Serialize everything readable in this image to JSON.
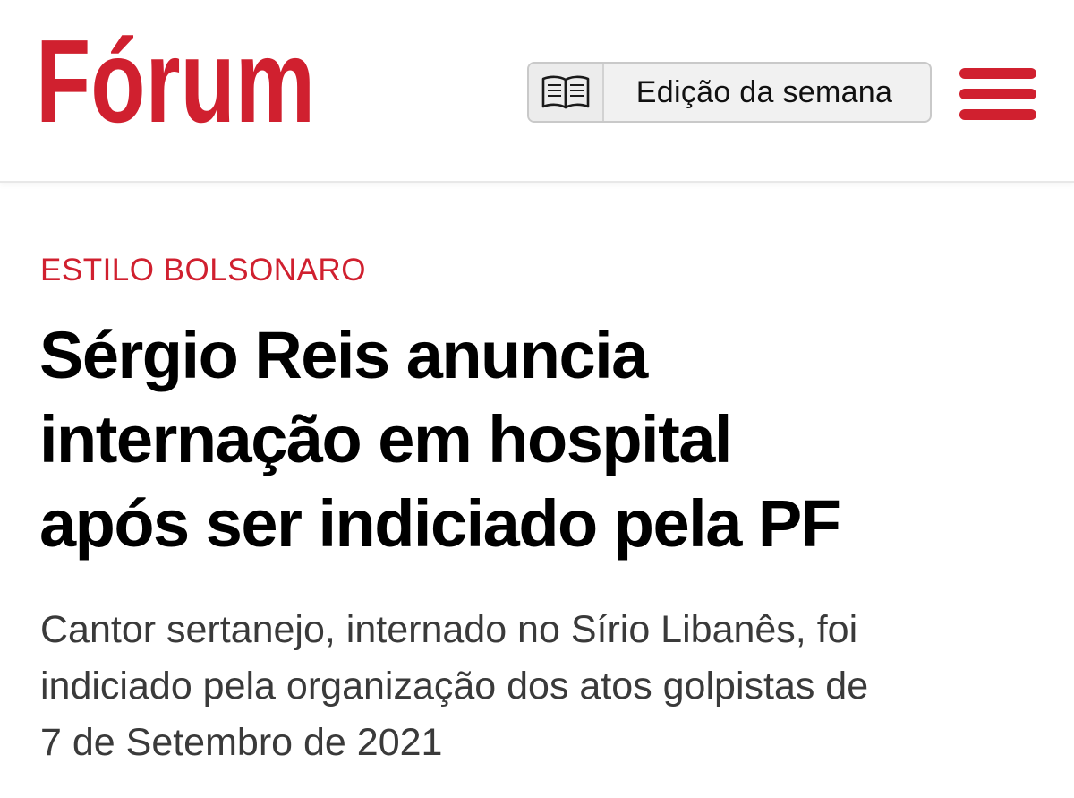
{
  "header": {
    "logo_text": "Fórum",
    "edition_button": {
      "label": "Edição da semana",
      "icon": "open-book-icon"
    },
    "menu_icon": "hamburger-menu-icon"
  },
  "article": {
    "kicker": "ESTILO BOLSONARO",
    "headline_lines": [
      "Sérgio Reis anuncia",
      "internação em hospital",
      "após ser indiciado pela PF"
    ],
    "subtitle_lines": [
      "Cantor sertanejo, internado no Sírio Libanês, foi",
      "indiciado pela organização dos atos golpistas de",
      "7 de Setembro de 2021"
    ]
  },
  "colors": {
    "brand_red": "#d0202f",
    "headline": "#000000",
    "subtitle": "#3a3a3a",
    "button_bg": "#f1f1f1"
  }
}
